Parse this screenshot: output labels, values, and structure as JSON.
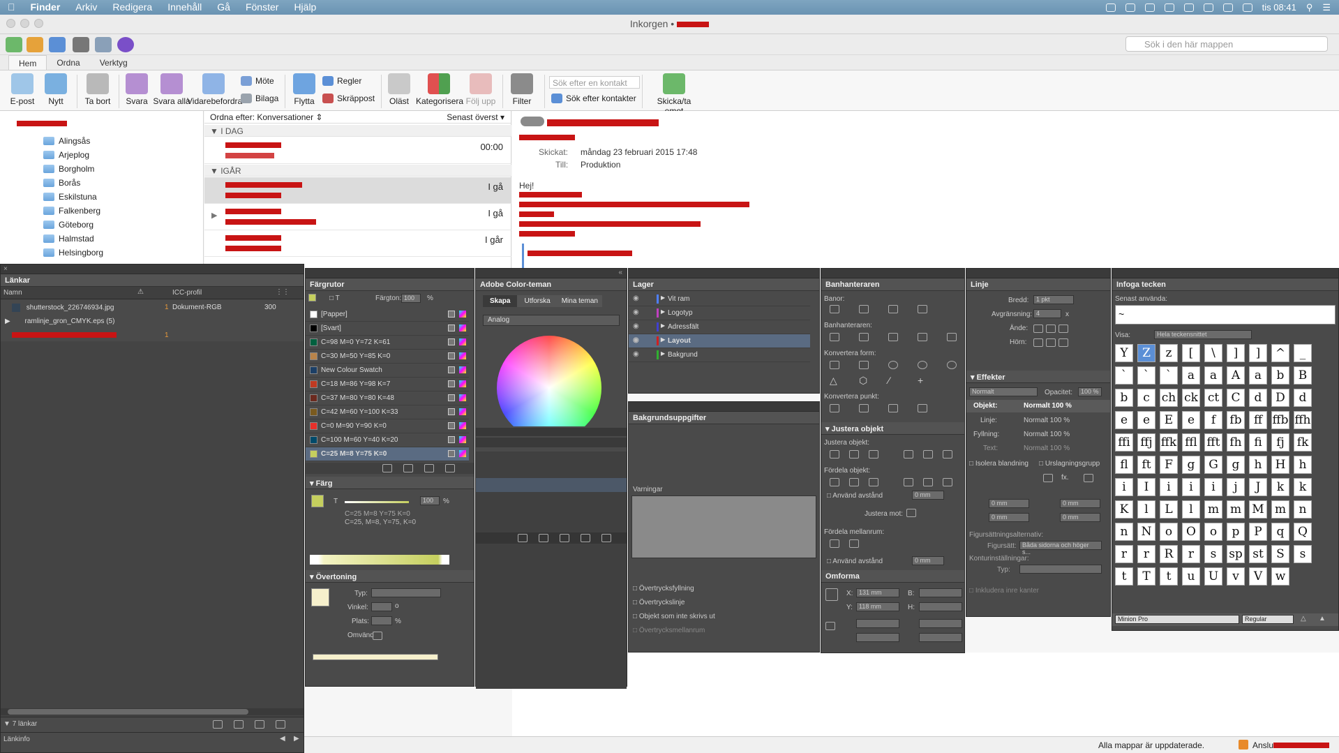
{
  "menubar": {
    "apple": "",
    "app": "Finder",
    "items": [
      "Arkiv",
      "Redigera",
      "Innehåll",
      "Gå",
      "Fönster",
      "Hjälp"
    ],
    "clock": "tis 08:41"
  },
  "outlook": {
    "window_title": "Inkorgen •",
    "search_placeholder": "Sök i den här mappen",
    "tabs": [
      "Hem",
      "Ordna",
      "Verktyg"
    ],
    "ribbon": {
      "epost": "E-post",
      "nytt": "Nytt",
      "ta_bort": "Ta bort",
      "svara": "Svara",
      "svara_alla": "Svara alla",
      "vidarebefordra": "Vidarebefordra",
      "mote": "Möte",
      "bilaga": "Bilaga",
      "flytta": "Flytta",
      "regler": "Regler",
      "skrappost": "Skräppost",
      "olast": "Oläst",
      "kategorisera": "Kategorisera",
      "folj_upp": "Följ upp",
      "filter": "Filter",
      "contact_placeholder": "Sök efter en kontakt",
      "sok_kontakter": "Sök efter kontakter",
      "skicka_ta_emot": "Skicka/ta emot"
    },
    "folders": [
      "Alingsås",
      "Arjeplog",
      "Borgholm",
      "Borås",
      "Eskilstuna",
      "Falkenberg",
      "Göteborg",
      "Halmstad",
      "Helsingborg"
    ],
    "sort": {
      "label": "Ordna efter: Konversationer",
      "order": "Senast överst"
    },
    "groups": {
      "today": "I DAG",
      "yesterday": "IGÅR"
    },
    "messages": [
      {
        "time": "00:00"
      },
      {
        "time": "I gå"
      },
      {
        "time": "I gå"
      },
      {
        "time": "I går"
      }
    ],
    "reading": {
      "sent_label": "Skickat:",
      "sent_value": "måndag 23 februari 2015 17:48",
      "to_label": "Till:",
      "to_value": "Produktion",
      "greeting": "Hej!"
    },
    "status": "Alla mappar är uppdaterade.",
    "status2": "Anslu"
  },
  "indesign": {
    "links": {
      "title": "Länkar",
      "col_name": "Namn",
      "col_icc": "ICC-profil",
      "rows": [
        {
          "name": "shutterstock_226746934.jpg",
          "num": "1",
          "icc": "Dokument-RGB",
          "res": "300"
        },
        {
          "name": "ramlinje_gron_CMYK.eps (5)",
          "num": "",
          "icc": "",
          "res": ""
        },
        {
          "name": "",
          "num": "1",
          "icc": "",
          "res": ""
        }
      ],
      "count": "7 länkar",
      "info": "Länkinfo"
    },
    "swatches": {
      "title": "Färgrutor",
      "tint_label": "Färgton:",
      "tint": "100",
      "pct": "%",
      "items": [
        {
          "name": "[Papper]",
          "color": "#ffffff"
        },
        {
          "name": "[Svart]",
          "color": "#000000"
        },
        {
          "name": "C=98 M=0 Y=72 K=61",
          "color": "#00603f"
        },
        {
          "name": "C=30 M=50 Y=85 K=0",
          "color": "#b9844a"
        },
        {
          "name": "New Colour Swatch",
          "color": "#1c3f66"
        },
        {
          "name": "C=18 M=86 Y=98 K=7",
          "color": "#c03a22"
        },
        {
          "name": "C=37 M=80 Y=80 K=48",
          "color": "#6b2a1f"
        },
        {
          "name": "C=42 M=60 Y=100 K=33",
          "color": "#7a5a1e"
        },
        {
          "name": "C=0 M=90 Y=90 K=0",
          "color": "#e8302a"
        },
        {
          "name": "C=100 M=60 Y=40 K=20",
          "color": "#004a6a"
        },
        {
          "name": "C=25 M=8 Y=75 K=0",
          "color": "#c5cf5e"
        }
      ]
    },
    "color": {
      "title": "Färg",
      "t_label": "T",
      "value": "100",
      "pct": "%",
      "line1": "C=25 M=8 Y=75 K=0",
      "line2": "C=25, M=8, Y=75, K=0"
    },
    "gradient": {
      "title": "Övertoning",
      "typ": "Typ:",
      "vinkel": "Vinkel:",
      "vinkel_unit": "o",
      "plats": "Plats:",
      "plats_unit": "%",
      "omvand": "Omvänd"
    },
    "adobe_color": {
      "title": "Adobe Color-teman",
      "tabs": [
        "Skapa",
        "Utforska",
        "Mina teman"
      ],
      "rule": "Analog"
    },
    "layers": {
      "title": "Lager",
      "items": [
        {
          "name": "Vit ram",
          "color": "#4f7fff"
        },
        {
          "name": "Logotyp",
          "color": "#c040c0"
        },
        {
          "name": "Adressfält",
          "color": "#4040d0"
        },
        {
          "name": "Layout",
          "color": "#d02020"
        },
        {
          "name": "Bakgrund",
          "color": "#30b030"
        }
      ]
    },
    "bg_task": {
      "title": "Bakgrundsuppgifter",
      "warnings": "Varningar"
    },
    "attributes": {
      "items": [
        "Övertrycksfyllning",
        "Övertryckslinje",
        "Objekt som inte skrivs ut",
        "Övertrycksmellanrum"
      ]
    },
    "pathfinder": {
      "title": "Banhanteraren",
      "banor": "Banor:",
      "banhanteraren": "Banhanteraren:",
      "konvertera_form": "Konvertera form:",
      "konvertera_punkt": "Konvertera punkt:"
    },
    "align": {
      "title": "Justera objekt",
      "justera": "Justera objekt:",
      "fordela": "Fördela objekt:",
      "anvand": "Använd avstånd",
      "anvand_val": "0 mm",
      "justera_mot": "Justera mot:",
      "fordela_mellan": "Fördela mellanrum:",
      "anvand2": "Använd avstånd",
      "anvand2_val": "0 mm"
    },
    "transform": {
      "title": "Omforma",
      "x": "X:",
      "x_val": "131 mm",
      "y": "Y:",
      "y_val": "118 mm",
      "b": "B:",
      "h": "H:"
    },
    "stroke": {
      "title": "Linje",
      "bredd": "Bredd:",
      "bredd_val": "1 pkt",
      "avrundning": "Avgränsning:",
      "avrundning_val": "4",
      "x": "x",
      "ande": "Ände:",
      "horn": "Hörn:"
    },
    "effects": {
      "title": "Effekter",
      "mode": "Normalt",
      "opacity_label": "Opacitet:",
      "opacity": "100 %",
      "rows": [
        {
          "k": "Objekt:",
          "v": "Normalt 100 %"
        },
        {
          "k": "Linje:",
          "v": "Normalt 100 %"
        },
        {
          "k": "Fyllning:",
          "v": "Normalt 100 %"
        },
        {
          "k": "Text:",
          "v": "Normalt 100 %"
        }
      ],
      "isolera": "Isolera blandning",
      "urslag": "Urslagningsgrupp"
    },
    "wrap": {
      "v1": "0 mm",
      "v2": "0 mm",
      "v3": "0 mm",
      "v4": "0 mm",
      "alt": "Figursättningsalternativ:",
      "figursatt": "Figursätt:",
      "figursatt_val": "Båda sidorna och höger s...",
      "kontur": "Konturinställningar:",
      "typ": "Typ:",
      "inkludera": "Inkludera inre kanter"
    },
    "glyphs": {
      "title": "Infoga tecken",
      "recent": "Senast använda:",
      "recent_first": "~",
      "visa": "Visa:",
      "visa_val": "Hela teckensnittet",
      "font": "Minion Pro",
      "style": "Regular",
      "cells": [
        "Y",
        "Z",
        "z",
        "[",
        "\\",
        "]",
        "]",
        "^",
        "_",
        "`",
        "`",
        "`",
        "a",
        "a",
        "A",
        "a",
        "b",
        "B",
        "b",
        "c",
        "ch",
        "ck",
        "ct",
        "C",
        "d",
        "D",
        "d",
        "e",
        "e",
        "E",
        "e",
        "f",
        "fb",
        "ff",
        "ffb",
        "ffh",
        "ffi",
        "ffj",
        "ffk",
        "ffl",
        "fft",
        "fh",
        "fi",
        "fj",
        "fk",
        "fl",
        "ft",
        "F",
        "g",
        "G",
        "g",
        "h",
        "H",
        "h",
        "i",
        "I",
        "i",
        "i",
        "i",
        "j",
        "J",
        "k",
        "k",
        "K",
        "l",
        "L",
        "l",
        "m",
        "m",
        "M",
        "m",
        "n",
        "n",
        "N",
        "o",
        "O",
        "o",
        "p",
        "P",
        "q",
        "Q",
        "r",
        "r",
        "R",
        "r",
        "s",
        "sp",
        "st",
        "S",
        "s",
        "t",
        "T",
        "t",
        "u",
        "U",
        "v",
        "V",
        "w"
      ]
    }
  }
}
